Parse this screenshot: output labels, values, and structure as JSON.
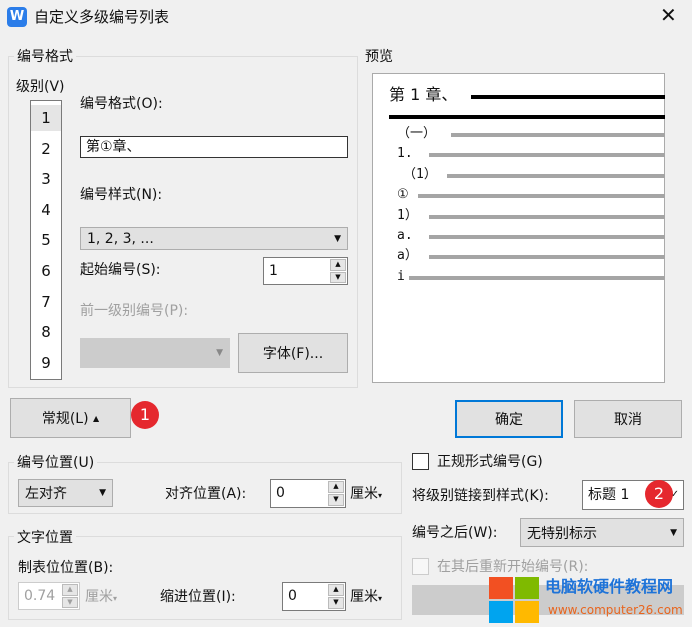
{
  "title": "自定义多级编号列表",
  "format_group": {
    "label": "编号格式",
    "level_label": "级别(V)",
    "levels": [
      "1",
      "2",
      "3",
      "4",
      "5",
      "6",
      "7",
      "8",
      "9"
    ],
    "selected_level": "1",
    "format_label": "编号格式(O):",
    "format_value": "第①章、",
    "style_label": "编号样式(N):",
    "style_value": "1, 2, 3, ...",
    "start_label": "起始编号(S):",
    "start_value": "1",
    "prev_label": "前一级别编号(P):",
    "font_button": "字体(F)..."
  },
  "preview": {
    "label": "预览",
    "level1": "第 1 章、",
    "items": [
      "（一）",
      "1.",
      "（1）",
      "①",
      "1）",
      "a.",
      "a）",
      "i"
    ]
  },
  "general_button": "常规(L)",
  "ok_button": "确定",
  "cancel_button": "取消",
  "badges": [
    "1",
    "2"
  ],
  "number_position": {
    "label": "编号位置(U)",
    "align_value": "左对齐",
    "align_pos_label": "对齐位置(A):",
    "align_pos_value": "0",
    "unit": "厘米"
  },
  "text_position": {
    "label": "文字位置",
    "tab_label": "制表位位置(B):",
    "tab_value": "0.74",
    "unit": "厘米",
    "indent_label": "缩进位置(I):",
    "indent_value": "0"
  },
  "right": {
    "legal_label": "正规形式编号(G)",
    "link_label": "将级别链接到样式(K):",
    "link_value": "标题 1",
    "after_label": "编号之后(W):",
    "after_value": "无特别标示",
    "restart_label": "在其后重新开始编号(R):"
  },
  "watermark": {
    "name": "电脑软硬件教程网",
    "url": "www.computer26.com"
  },
  "colors": {
    "accent": "#0078d7",
    "badge": "#e5282e",
    "app_icon": "#2b7de9"
  }
}
